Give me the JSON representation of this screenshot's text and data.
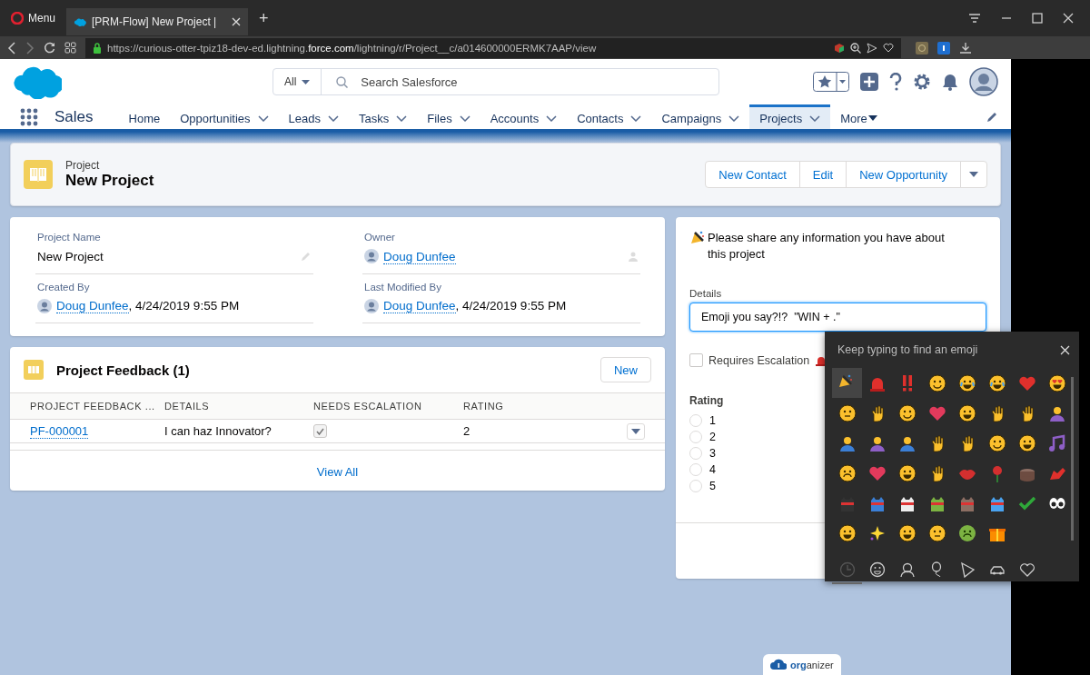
{
  "browser": {
    "menu_label": "Menu",
    "tab_title": "[PRM-Flow] New Project |",
    "new_tab": "+",
    "url": "https://curious-otter-tpiz18-dev-ed.lightning.**force.com**/lightning/r/Project__c/a014600000ERMK7AAP/view"
  },
  "header": {
    "search_scope": "All",
    "search_placeholder": "Search Salesforce",
    "app_name": "Sales",
    "nav": [
      {
        "label": "Home",
        "kind": "plain",
        "selected": false
      },
      {
        "label": "Opportunities",
        "kind": "dropdown",
        "selected": false
      },
      {
        "label": "Leads",
        "kind": "dropdown",
        "selected": false
      },
      {
        "label": "Tasks",
        "kind": "dropdown",
        "selected": false
      },
      {
        "label": "Files",
        "kind": "dropdown",
        "selected": false
      },
      {
        "label": "Accounts",
        "kind": "dropdown",
        "selected": false
      },
      {
        "label": "Contacts",
        "kind": "dropdown",
        "selected": false
      },
      {
        "label": "Campaigns",
        "kind": "dropdown",
        "selected": false
      },
      {
        "label": "Projects",
        "kind": "dropdown",
        "selected": true
      },
      {
        "label": "More",
        "kind": "overflow",
        "selected": false
      }
    ]
  },
  "record": {
    "object_type": "Project",
    "title": "New Project",
    "actions": [
      "New Contact",
      "Edit",
      "New Opportunity"
    ]
  },
  "fields": [
    {
      "label": "Project Name",
      "kind": "text",
      "value": "New Project",
      "editable": true
    },
    {
      "label": "Owner",
      "kind": "user",
      "value": "Doug Dunfee",
      "editable": true
    },
    {
      "label": "Created By",
      "kind": "user",
      "value": "Doug Dunfee",
      "suffix": ", 4/24/2019 9:55 PM"
    },
    {
      "label": "Last Modified By",
      "kind": "user",
      "value": "Doug Dunfee",
      "suffix": ", 4/24/2019 9:55 PM"
    }
  ],
  "related": {
    "title": "Project Feedback (1)",
    "new_button": "New",
    "columns": [
      "PROJECT FEEDBACK ...",
      "DETAILS",
      "NEEDS ESCALATION",
      "RATING"
    ],
    "rows": [
      {
        "name": "PF-000001",
        "details": "I can haz Innovator?",
        "needs_escalation": true,
        "rating": "2"
      }
    ],
    "view_all": "View All"
  },
  "flow": {
    "prompt": "Please share any information you have about this project",
    "details_label": "Details",
    "details_value": "Emoji you say?!?  \"WIN + .\"",
    "checkbox": {
      "label": "Requires Escalation",
      "checked": false
    },
    "rating_label": "Rating",
    "options": [
      {
        "label": "1",
        "selected": false
      },
      {
        "label": "2",
        "selected": false
      },
      {
        "label": "3",
        "selected": false
      },
      {
        "label": "4",
        "selected": false
      },
      {
        "label": "5",
        "selected": false
      }
    ]
  },
  "emoji_picker": {
    "hint": "Keep typing to find an emoji",
    "emojis": [
      {
        "selected": true
      },
      {
        "selected": false
      },
      {
        "selected": false
      },
      {
        "selected": false
      },
      {
        "selected": false
      },
      {
        "selected": false
      },
      {
        "selected": false
      },
      {
        "selected": false
      },
      {
        "selected": false
      },
      {
        "selected": false
      },
      {
        "selected": false
      },
      {
        "selected": false
      },
      {
        "selected": false
      },
      {
        "selected": false
      },
      {
        "selected": false
      },
      {
        "selected": false
      },
      {
        "selected": false
      },
      {
        "selected": false
      },
      {
        "selected": false
      },
      {
        "selected": false
      },
      {
        "selected": false
      },
      {
        "selected": false
      },
      {
        "selected": false
      },
      {
        "selected": false
      },
      {
        "selected": false
      },
      {
        "selected": false
      },
      {
        "selected": false
      },
      {
        "selected": false
      },
      {
        "selected": false
      },
      {
        "selected": false
      },
      {
        "selected": false
      },
      {
        "selected": false
      },
      {
        "selected": false
      },
      {
        "selected": false
      },
      {
        "selected": false
      },
      {
        "selected": false
      },
      {
        "selected": false
      },
      {
        "selected": false
      },
      {
        "selected": false
      },
      {
        "selected": false
      },
      {
        "selected": false
      },
      {
        "selected": false
      },
      {
        "selected": false
      },
      {
        "selected": false
      },
      {
        "selected": false
      },
      {
        "selected": false
      }
    ],
    "categories": [
      {
        "selected": true
      },
      {
        "selected": false
      },
      {
        "selected": false
      },
      {
        "selected": false
      },
      {
        "selected": false
      },
      {
        "selected": false
      },
      {
        "selected": false
      }
    ]
  },
  "organizer": {
    "label": "**org**anizer"
  }
}
